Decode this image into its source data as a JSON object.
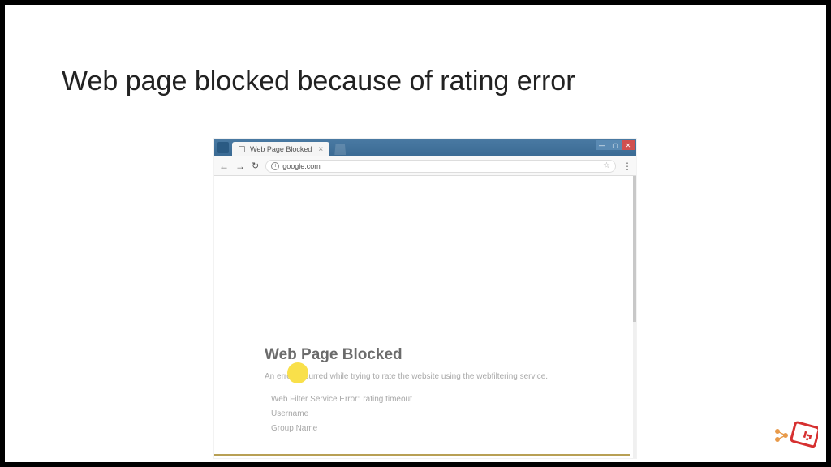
{
  "slide": {
    "title": "Web page blocked because of rating error"
  },
  "browser": {
    "tab_title": "Web Page Blocked",
    "url": "google.com",
    "window_controls": {
      "min": "—",
      "max": "▢",
      "close": "✕"
    },
    "nav": {
      "back": "←",
      "forward": "→",
      "reload": "↻"
    },
    "info_glyph": "i",
    "star_glyph": "☆",
    "menu_glyph": "⋮"
  },
  "blocked": {
    "heading": "Web Page Blocked",
    "description": "An error occurred while trying to rate the website using the webfiltering service.",
    "details": {
      "error_label": "Web Filter Service Error:",
      "error_value": "rating timeout",
      "username_label": "Username",
      "group_label": "Group Name"
    }
  }
}
